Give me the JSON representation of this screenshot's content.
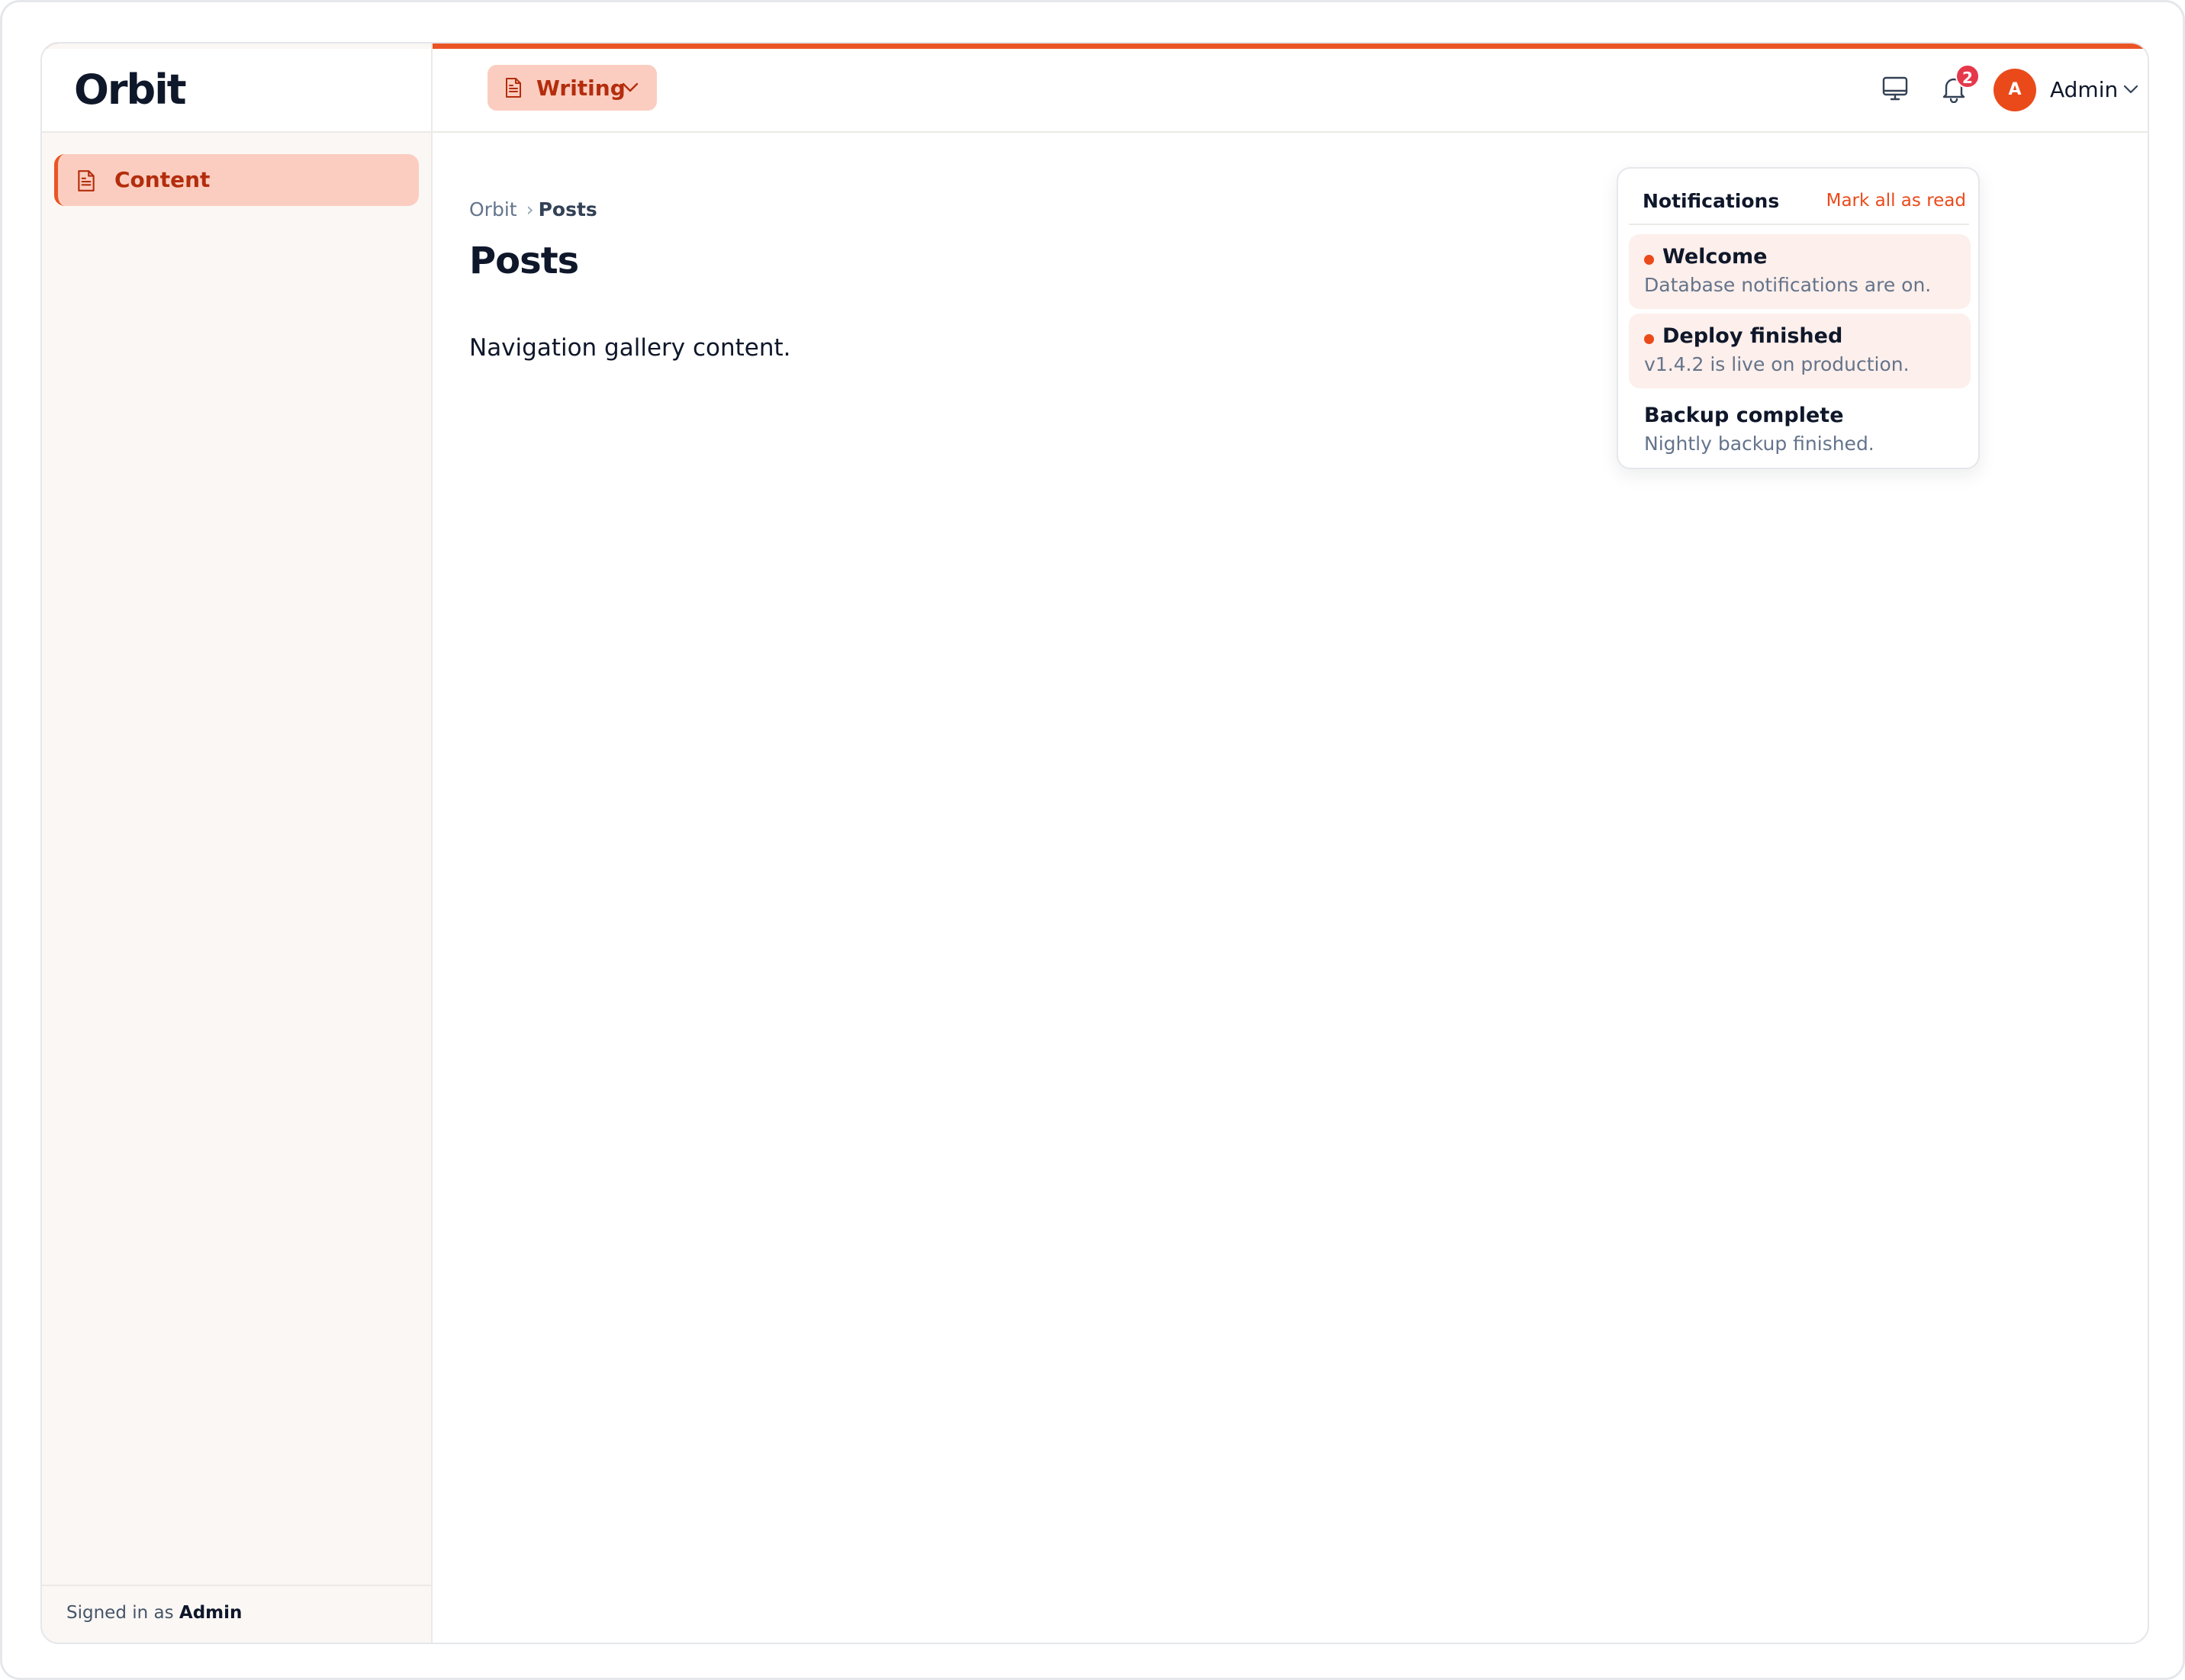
{
  "app": {
    "brand": "Orbit"
  },
  "topbar": {
    "tenant_label": "Writing",
    "notification_count": "2",
    "user": {
      "initial": "A",
      "name": "Admin"
    }
  },
  "sidebar": {
    "items": [
      {
        "label": "Content",
        "active": true
      }
    ],
    "footer": {
      "prefix": "Signed in as",
      "user": "Admin"
    }
  },
  "breadcrumb": {
    "root": "Orbit",
    "current": "Posts"
  },
  "page": {
    "title": "Posts",
    "body": "Navigation gallery content."
  },
  "notifications": {
    "title": "Notifications",
    "mark_all": "Mark all as read",
    "items": [
      {
        "title": "Welcome",
        "description": "Database notifications are on.",
        "unread": true
      },
      {
        "title": "Deploy finished",
        "description": "v1.4.2 is live on production.",
        "unread": true
      },
      {
        "title": "Backup complete",
        "description": "Nightly backup finished.",
        "unread": false
      }
    ]
  },
  "colors": {
    "accent": "#ea5425",
    "accent_soft": "#fbcdc0",
    "badge": "#e6384b",
    "sidebar_bg": "#faf7f4"
  },
  "icons": [
    "document-icon",
    "chevron-down-icon",
    "monitor-icon",
    "bell-icon"
  ]
}
